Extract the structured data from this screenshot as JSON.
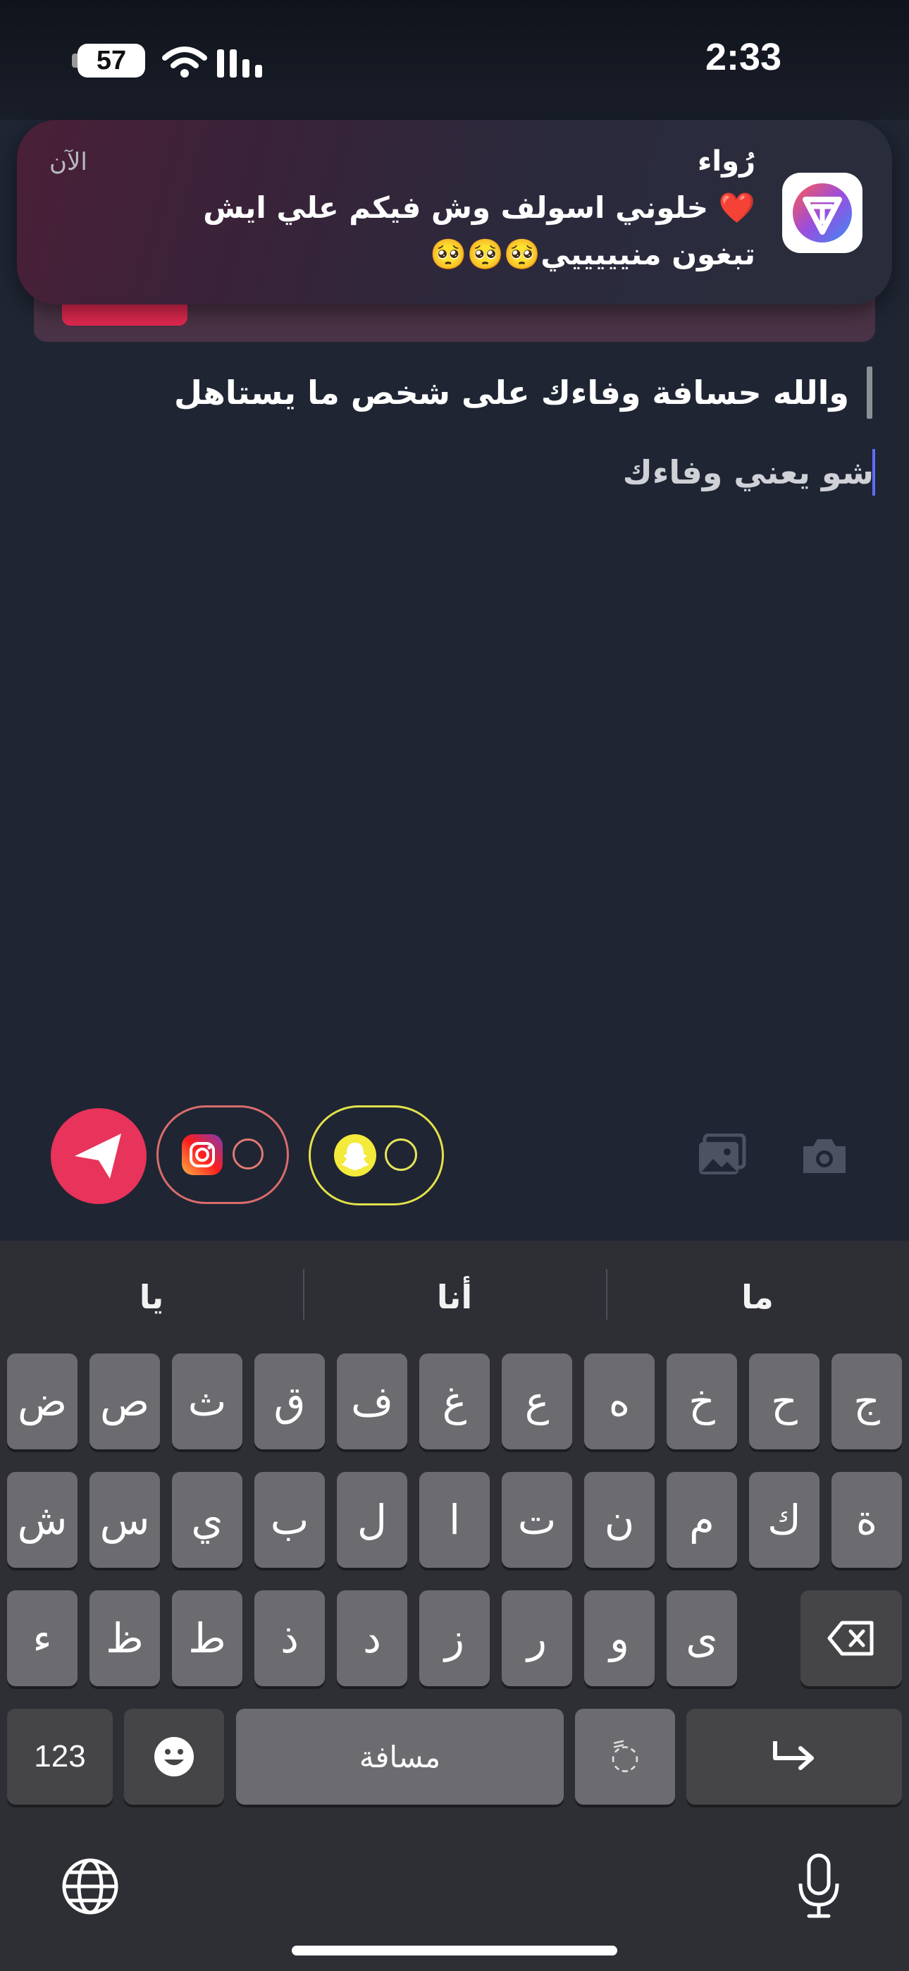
{
  "status_bar": {
    "time": "2:33",
    "battery": "57"
  },
  "reply_card": {
    "button_label": ""
  },
  "notification": {
    "sender": "رُواء",
    "time": "الآن",
    "message": "❤️ خلوني اسولف وش فيكم علي ايش تبغون منيييييي🥺🥺🥺"
  },
  "chat": {
    "quoted_message": "والله حسافة وفاءك على شخص ما يستاهل",
    "input_text": "شو يعني وفاءك"
  },
  "keyboard": {
    "suggestions": [
      "ما",
      "أنا",
      "يا"
    ],
    "row1": [
      "ج",
      "ح",
      "خ",
      "ه",
      "ع",
      "غ",
      "ف",
      "ق",
      "ث",
      "ص",
      "ض"
    ],
    "row2": [
      "ة",
      "ك",
      "م",
      "ن",
      "ت",
      "ا",
      "ل",
      "ب",
      "ي",
      "س",
      "ش"
    ],
    "row3": [
      "ى",
      "و",
      "ر",
      "ز",
      "د",
      "ذ",
      "ط",
      "ظ",
      "ء"
    ],
    "numbers_key": "123",
    "space_key": "مسافة",
    "diacritic_key": "◌ً"
  },
  "icons": {
    "wifi": "wifi-icon",
    "signal": "signal-icon",
    "send": "send-icon",
    "gallery": "gallery-icon",
    "camera": "camera-icon",
    "emoji": "emoji-icon",
    "globe": "globe-icon",
    "mic": "microphone-icon",
    "delete": "backspace-icon",
    "return": "return-icon"
  },
  "colors": {
    "accent": "#e8335a",
    "background": "#1f2533",
    "keyboard": "#2d2f35",
    "snap_yellow": "#f4ea3b"
  }
}
